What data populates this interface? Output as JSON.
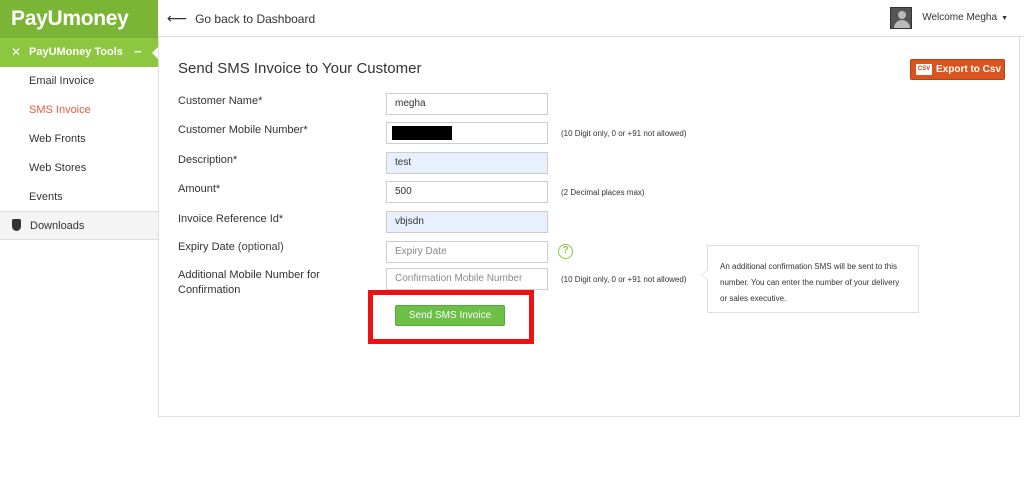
{
  "brand": {
    "logo": "PayUmoney"
  },
  "sidebar": {
    "section_title": "PayUMoney Tools",
    "collapse_symbol": "−",
    "items": [
      {
        "label": "Email Invoice",
        "active": false
      },
      {
        "label": "SMS Invoice",
        "active": true
      },
      {
        "label": "Web Fronts",
        "active": false
      },
      {
        "label": "Web Stores",
        "active": false
      },
      {
        "label": "Events",
        "active": false
      }
    ],
    "downloads_label": "Downloads"
  },
  "header": {
    "back_label": "Go back to Dashboard",
    "welcome": "Welcome Megha"
  },
  "main": {
    "title": "Send SMS Invoice to Your Customer",
    "export_label": "Export to Csv",
    "export_badge": "CSV",
    "fields": {
      "customer_name": {
        "label": "Customer Name*",
        "value": "megha"
      },
      "mobile": {
        "label": "Customer Mobile Number*",
        "value": "",
        "hint": "(10 Digit only, 0 or +91 not allowed)"
      },
      "description": {
        "label": "Description*",
        "value": "test"
      },
      "amount": {
        "label": "Amount*",
        "value": "500",
        "hint": "(2 Decimal places max)"
      },
      "invoice_ref": {
        "label": "Invoice Reference Id*",
        "value": "vbjsdn"
      },
      "expiry": {
        "label": "Expiry Date",
        "label_suffix": "(optional)",
        "placeholder": "Expiry Date",
        "help": "?"
      },
      "confirm_mobile": {
        "label_line1": "Additional Mobile Number for",
        "label_line2": "Confirmation",
        "placeholder": "Confirmation Mobile Number",
        "hint": "(10 Digit only, 0 or +91 not allowed)"
      }
    },
    "tooltip": "An additional confirmation SMS will be sent to this number. You can enter the number of your delivery or sales executive.",
    "submit_label": "Send SMS Invoice"
  },
  "colors": {
    "brand_green": "#7bb536",
    "button_green": "#6cbf47",
    "export_orange": "#d9541e",
    "active_menu": "#e55a3a",
    "highlight_red": "#ee1111"
  },
  "icons": [
    "tools-icon",
    "arrow-left-icon",
    "user-avatar-icon",
    "caret-down-icon",
    "shield-icon",
    "csv-icon",
    "help-icon"
  ]
}
